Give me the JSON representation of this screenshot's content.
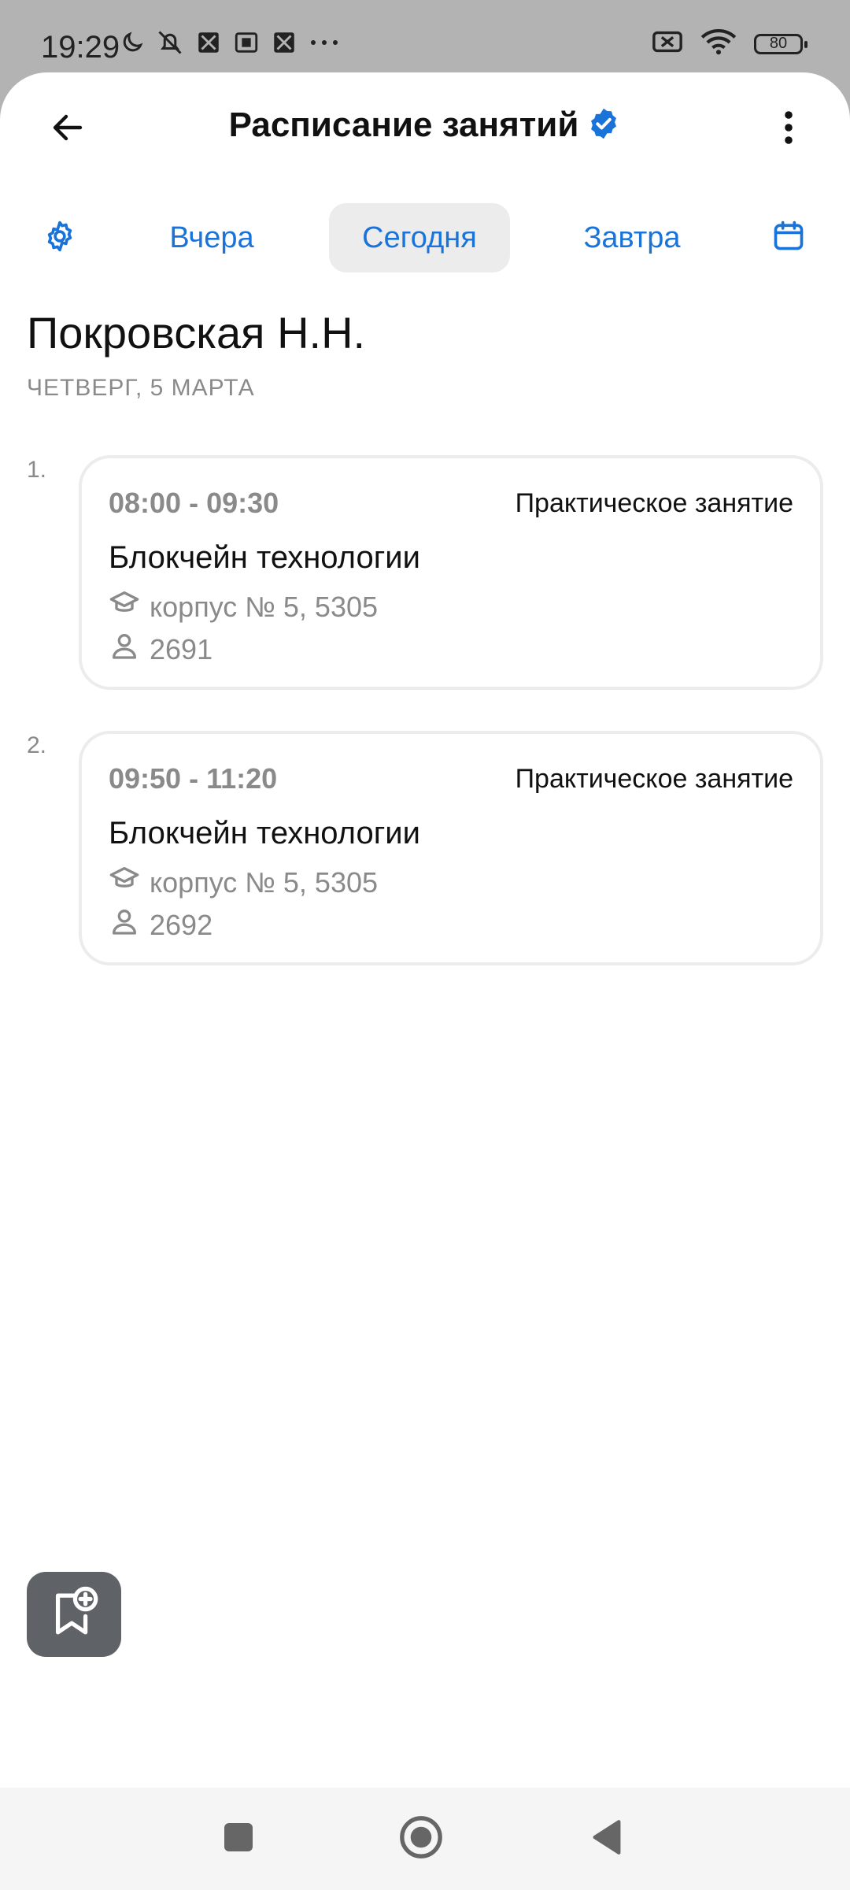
{
  "status_bar": {
    "time": "19:29",
    "battery": "80"
  },
  "appbar": {
    "title": "Расписание занятий"
  },
  "day_tabs": {
    "yesterday": "Вчера",
    "today": "Сегодня",
    "tomorrow": "Завтра",
    "selected": "today"
  },
  "teacher": {
    "name": "Покровская Н.Н.",
    "date": "ЧЕТВЕРГ, 5 МАРТА"
  },
  "lessons": [
    {
      "number": "1.",
      "time": "08:00 - 09:30",
      "type": "Практическое занятие",
      "subject": "Блокчейн технологии",
      "room": "корпус № 5, 5305",
      "group": "2691"
    },
    {
      "number": "2.",
      "time": "09:50 - 11:20",
      "type": "Практическое занятие",
      "subject": "Блокчейн технологии",
      "room": "корпус № 5, 5305",
      "group": "2692"
    }
  ],
  "colors": {
    "accent": "#1a73d9",
    "verified": "#1a73d9",
    "fab": "#5f6368"
  },
  "icons": {
    "back": "arrow-left-icon",
    "verified": "verified-badge-icon",
    "more": "more-vertical-icon",
    "settings": "gear-icon",
    "calendar": "calendar-icon",
    "room": "graduation-cap-icon",
    "group": "person-icon",
    "fab": "bookmark-add-icon"
  }
}
